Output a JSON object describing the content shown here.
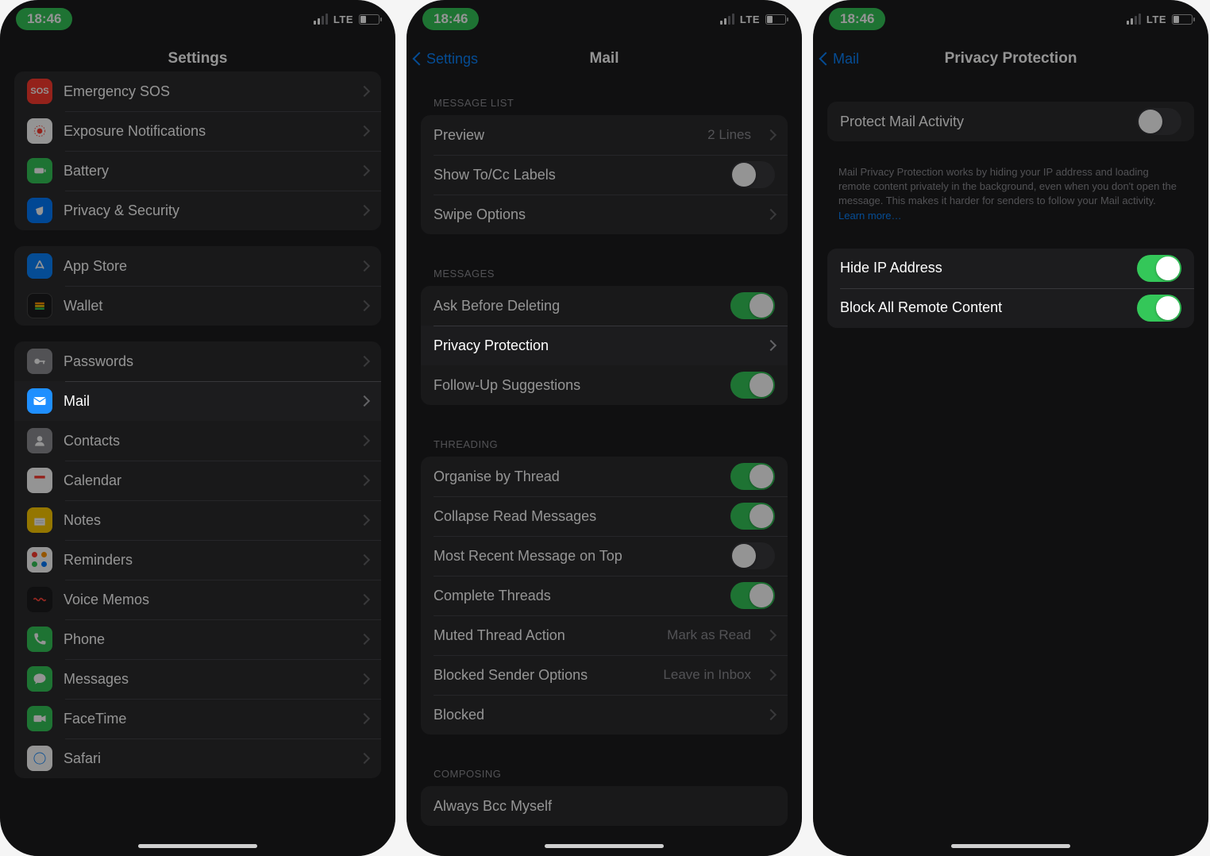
{
  "status": {
    "time": "18:46",
    "network": "LTE"
  },
  "screen1": {
    "title": "Settings",
    "groupA": [
      {
        "icon": "sos-icon",
        "label": "Emergency SOS"
      },
      {
        "icon": "exposure-icon",
        "label": "Exposure Notifications"
      },
      {
        "icon": "battery-icon",
        "label": "Battery"
      },
      {
        "icon": "privacy-icon",
        "label": "Privacy & Security"
      }
    ],
    "groupB": [
      {
        "icon": "appstore-icon",
        "label": "App Store"
      },
      {
        "icon": "wallet-icon",
        "label": "Wallet"
      }
    ],
    "groupC": [
      {
        "icon": "passwords-icon",
        "label": "Passwords"
      },
      {
        "icon": "mail-icon",
        "label": "Mail",
        "highlighted": true
      },
      {
        "icon": "contacts-icon",
        "label": "Contacts"
      },
      {
        "icon": "calendar-icon",
        "label": "Calendar"
      },
      {
        "icon": "notes-icon",
        "label": "Notes"
      },
      {
        "icon": "reminders-icon",
        "label": "Reminders"
      },
      {
        "icon": "voicememos-icon",
        "label": "Voice Memos"
      },
      {
        "icon": "phone-icon",
        "label": "Phone"
      },
      {
        "icon": "messages-icon",
        "label": "Messages"
      },
      {
        "icon": "facetime-icon",
        "label": "FaceTime"
      },
      {
        "icon": "safari-icon",
        "label": "Safari"
      }
    ]
  },
  "screen2": {
    "back": "Settings",
    "title": "Mail",
    "section_message_list": "MESSAGE LIST",
    "preview": {
      "label": "Preview",
      "value": "2 Lines"
    },
    "show_tocc": {
      "label": "Show To/Cc Labels",
      "on": false
    },
    "swipe_options": "Swipe Options",
    "section_messages": "MESSAGES",
    "ask_before_deleting": {
      "label": "Ask Before Deleting",
      "on": true
    },
    "privacy_protection": "Privacy Protection",
    "follow_up": {
      "label": "Follow-Up Suggestions",
      "on": true
    },
    "section_threading": "THREADING",
    "organise": {
      "label": "Organise by Thread",
      "on": true
    },
    "collapse": {
      "label": "Collapse Read Messages",
      "on": true
    },
    "most_recent": {
      "label": "Most Recent Message on Top",
      "on": false
    },
    "complete": {
      "label": "Complete Threads",
      "on": true
    },
    "muted": {
      "label": "Muted Thread Action",
      "value": "Mark as Read"
    },
    "blocked_sender": {
      "label": "Blocked Sender Options",
      "value": "Leave in Inbox"
    },
    "blocked": "Blocked",
    "section_composing": "COMPOSING",
    "always_bcc": "Always Bcc Myself"
  },
  "screen3": {
    "back": "Mail",
    "title": "Privacy Protection",
    "protect": {
      "label": "Protect Mail Activity",
      "on": false
    },
    "footer": "Mail Privacy Protection works by hiding your IP address and loading remote content privately in the background, even when you don't open the message. This makes it harder for senders to follow your Mail activity. ",
    "learn_more": "Learn more…",
    "hide_ip": {
      "label": "Hide IP Address",
      "on": true
    },
    "block_remote": {
      "label": "Block All Remote Content",
      "on": true
    }
  }
}
